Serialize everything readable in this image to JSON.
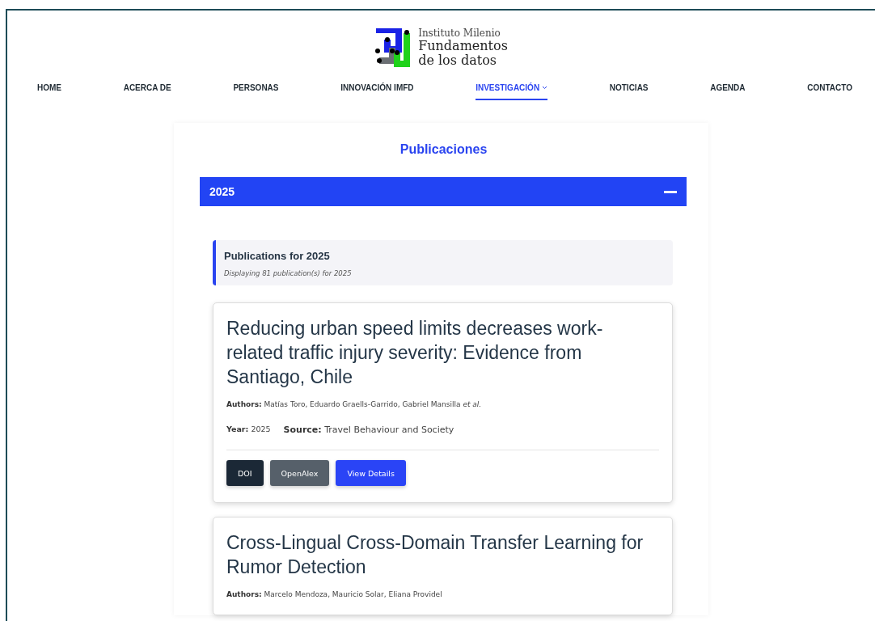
{
  "logo": {
    "line1": "Instituto Milenio",
    "line2": "Fundamentos",
    "line3": "de los datos"
  },
  "nav": [
    {
      "label": "HOME",
      "selected": false,
      "dropdown": false
    },
    {
      "label": "ACERCA DE",
      "selected": false,
      "dropdown": false
    },
    {
      "label": "PERSONAS",
      "selected": false,
      "dropdown": false
    },
    {
      "label": "INNOVACIÓN IMFD",
      "selected": false,
      "dropdown": false
    },
    {
      "label": "INVESTIGACIÓN",
      "selected": true,
      "dropdown": true
    },
    {
      "label": "NOTICIAS",
      "selected": false,
      "dropdown": false
    },
    {
      "label": "AGENDA",
      "selected": false,
      "dropdown": false
    },
    {
      "label": "CONTACTO",
      "selected": false,
      "dropdown": false
    }
  ],
  "page_title": "Publicaciones",
  "year_section": {
    "label": "2025",
    "expanded": true
  },
  "info": {
    "title": "Publications for 2025",
    "subtitle": "Displaying 81 publication(s) for 2025"
  },
  "publications": [
    {
      "title": "Reducing urban speed limits decreases work-related traffic injury severity: Evidence from Santiago, Chile",
      "authors_label": "Authors:",
      "authors": "Matías Toro, Eduardo Graells-Garrido, Gabriel Mansilla *et al.*",
      "year_label": "Year:",
      "year": "2025",
      "source_label": "Source:",
      "source": "Travel Behaviour and Society",
      "buttons": [
        {
          "label": "DOI",
          "kind": "dark"
        },
        {
          "label": "OpenAlex",
          "kind": "grey"
        },
        {
          "label": "View Details",
          "kind": "primary"
        }
      ]
    },
    {
      "title": "Cross-Lingual Cross-Domain Transfer Learning for Rumor Detection",
      "authors_label": "Authors:",
      "authors": "Marcelo Mendoza, Mauricio Solar, Eliana Providel"
    }
  ]
}
